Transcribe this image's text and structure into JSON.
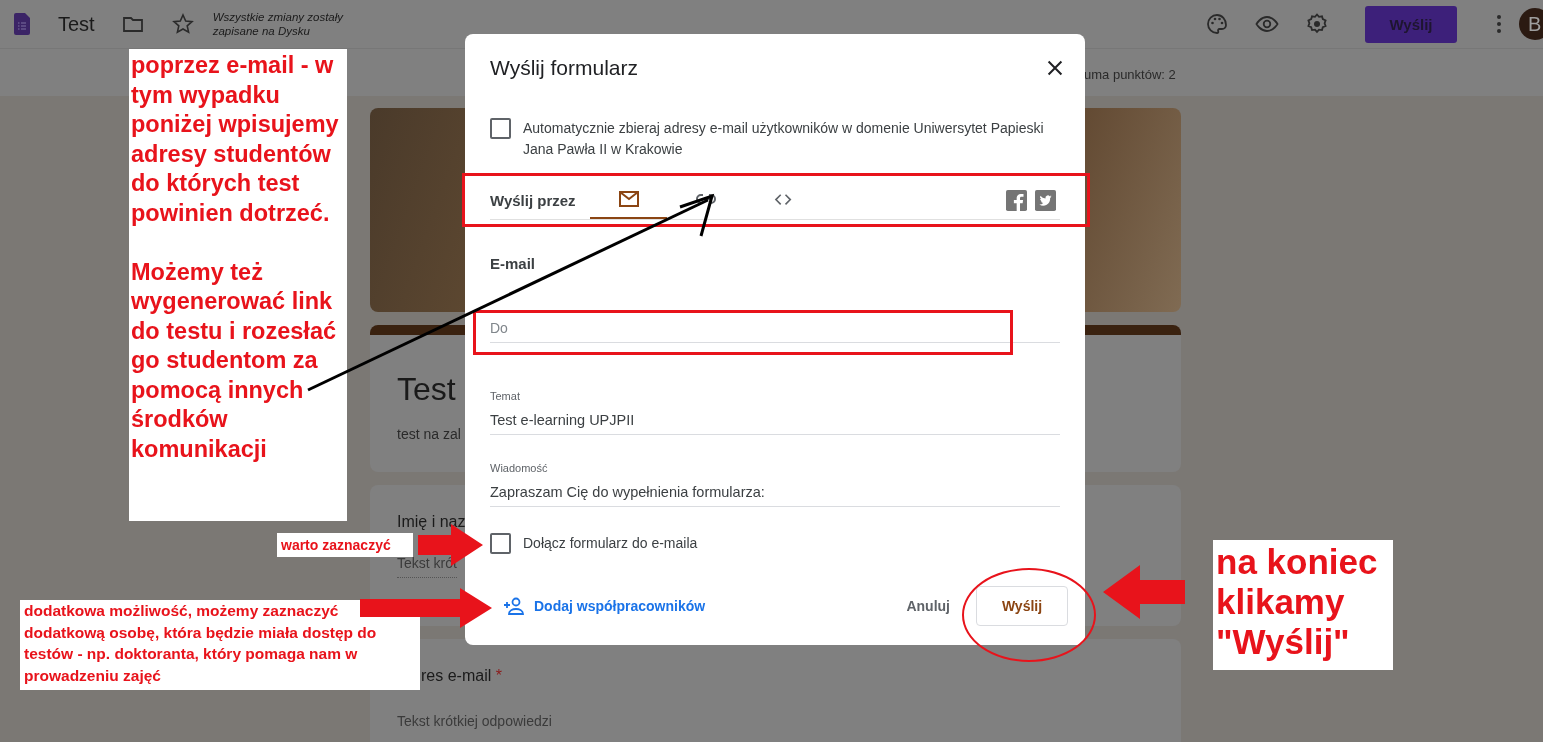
{
  "topbar": {
    "title": "Test",
    "save_status": "Wszystkie zmiany zostały zapisane na Dysku",
    "send_button": "Wyślij",
    "avatar": "B"
  },
  "points_summary": "uma punktów: 2",
  "form": {
    "title": "Test",
    "description": "test na zal",
    "questions": [
      {
        "label": "Imię i naz",
        "hint": "Tekst krót"
      },
      {
        "label": "res e-mail",
        "required_mark": "*",
        "hint": "Tekst krótkiej odpowiedzi"
      }
    ]
  },
  "dialog": {
    "title": "Wyślij formularz",
    "collect_emails": {
      "label": "Automatycznie zbieraj adresy e-mail użytkowników w domenie Uniwersytet Papieski Jana Pawła II w Krakowie",
      "checked": false
    },
    "send_via_label": "Wyślij przez",
    "send_methods": [
      {
        "kind": "email",
        "selected": true
      },
      {
        "kind": "link",
        "selected": false
      },
      {
        "kind": "embed",
        "selected": false
      }
    ],
    "section_title": "E-mail",
    "to_field": {
      "placeholder": "Do"
    },
    "subject": {
      "label": "Temat",
      "value": "Test e-learning UPJPII"
    },
    "message": {
      "label": "Wiadomość",
      "value": "Zapraszam Cię do wypełnienia formularza:"
    },
    "include_form": {
      "label": "Dołącz formularz do e-maila",
      "checked": false
    },
    "add_collaborators": "Dodaj współpracowników",
    "cancel_button": "Anuluj",
    "send_button": "Wyślij"
  },
  "annotations": [
    {
      "kind": "side",
      "paragraphs": [
        "poprzez e-mail - w tym wypadku poniżej wpisujemy adresy studentów do których test powinien dotrzeć.",
        "Możemy też wygenerować link do testu i rozesłać go studentom za pomocą innych środków komunikacji"
      ]
    },
    {
      "kind": "small",
      "paragraphs": [
        "warto zaznaczyć"
      ]
    },
    {
      "kind": "bottom",
      "paragraphs": [
        "dodatkowa możliwość, możemy zaznaczyć dodatkową osobę, która będzie miała dostęp do testów - np. doktoranta, który pomaga nam w prowadzeniu zajęć"
      ]
    },
    {
      "kind": "big",
      "paragraphs": [
        "na koniec klikamy \"Wyślij\""
      ]
    }
  ]
}
